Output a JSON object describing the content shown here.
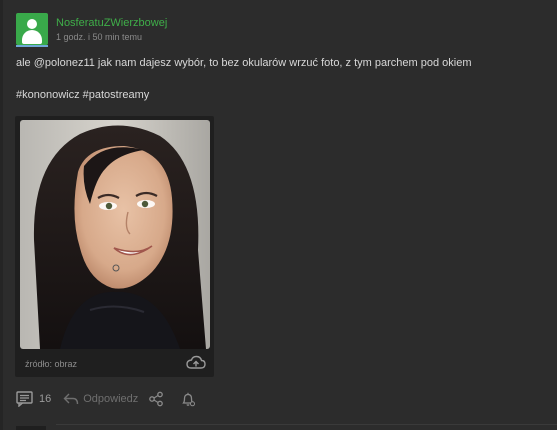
{
  "post": {
    "author": "NosferatuZWierzbowej",
    "time": "1 godz. i 50 min temu",
    "text_before": "ale ",
    "mention": "@polonez11",
    "text_after": " jak nam dajesz wybór, to bez okularów wrzuć foto, z tym parchem pod okiem",
    "tags": "#kononowicz #patostreamy"
  },
  "embed": {
    "source_label": "źródło: obraz"
  },
  "actions": {
    "comments_count": "16",
    "reply_label": "Odpowiedz"
  },
  "colors": {
    "background": "#2c2c2c",
    "username": "#3fae49",
    "avatar": "#39a94a",
    "embed_bg": "#1f1f1f"
  },
  "icons": [
    "user-avatar-icon",
    "upload-cloud-icon",
    "comments-icon",
    "reply-icon",
    "share-icon",
    "bell-icon"
  ]
}
